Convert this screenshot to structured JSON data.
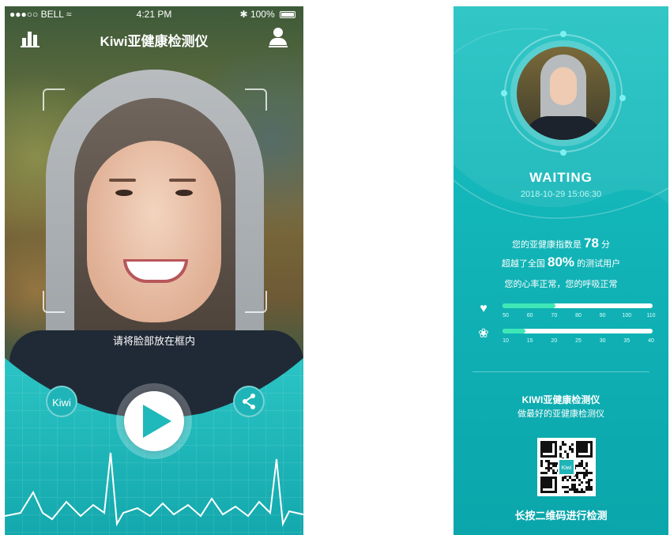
{
  "left_screen": {
    "status": {
      "carrier": "●●●○○ BELL",
      "time": "4:21 PM",
      "battery": "100%"
    },
    "title": "Kiwi亚健康检测仪",
    "face_hint": "请将脸部放在框内",
    "kiwi_button_label": "Kiwi",
    "icons": {
      "stats": "bar-chart-icon",
      "profile": "user-icon",
      "share": "share-icon",
      "play": "play-icon"
    }
  },
  "right_screen": {
    "status_label": "WAITING",
    "datetime": "2018-10-29  15:06:30",
    "stats": {
      "index_prefix": "您的亚健康指数是",
      "index_value": "78",
      "index_suffix": "分",
      "beat_prefix": "超越了全国",
      "beat_value": "80%",
      "beat_suffix": "的测试用户",
      "summary": "您的心率正常，您的呼吸正常"
    },
    "heart_rate": {
      "icon": "heart-rate-icon",
      "ticks": [
        "50",
        "60",
        "70",
        "80",
        "90",
        "100",
        "110"
      ],
      "fill_fraction": 0.35
    },
    "breathing": {
      "icon": "lungs-icon",
      "ticks": [
        "10",
        "15",
        "20",
        "25",
        "30",
        "35",
        "40"
      ],
      "fill_fraction": 0.15
    },
    "brand": "KIWI亚健康检测仪",
    "slogan": "做最好的亚健康检测仪",
    "qr_logo": "Kiwi",
    "scan_text": "长按二维码进行检测"
  },
  "colors": {
    "teal": "#1fb5b8",
    "bar_fill": "#3ee7b6"
  }
}
